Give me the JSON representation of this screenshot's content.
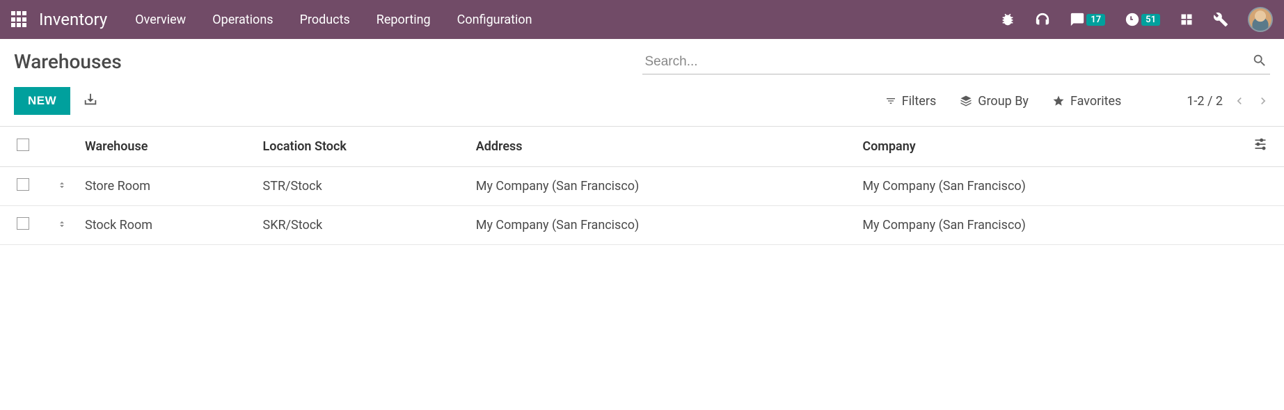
{
  "navbar": {
    "brand": "Inventory",
    "menu": [
      "Overview",
      "Operations",
      "Products",
      "Reporting",
      "Configuration"
    ],
    "messages_badge": "17",
    "activities_badge": "51"
  },
  "page": {
    "title": "Warehouses",
    "new_button": "NEW"
  },
  "search": {
    "placeholder": "Search..."
  },
  "filters": {
    "filters_label": "Filters",
    "groupby_label": "Group By",
    "favorites_label": "Favorites"
  },
  "pager": {
    "range": "1-2 / 2"
  },
  "table": {
    "headers": {
      "warehouse": "Warehouse",
      "location_stock": "Location Stock",
      "address": "Address",
      "company": "Company"
    },
    "rows": [
      {
        "warehouse": "Store Room",
        "location_stock": "STR/Stock",
        "address": "My Company (San Francisco)",
        "company": "My Company (San Francisco)"
      },
      {
        "warehouse": "Stock Room",
        "location_stock": "SKR/Stock",
        "address": "My Company (San Francisco)",
        "company": "My Company (San Francisco)"
      }
    ]
  }
}
